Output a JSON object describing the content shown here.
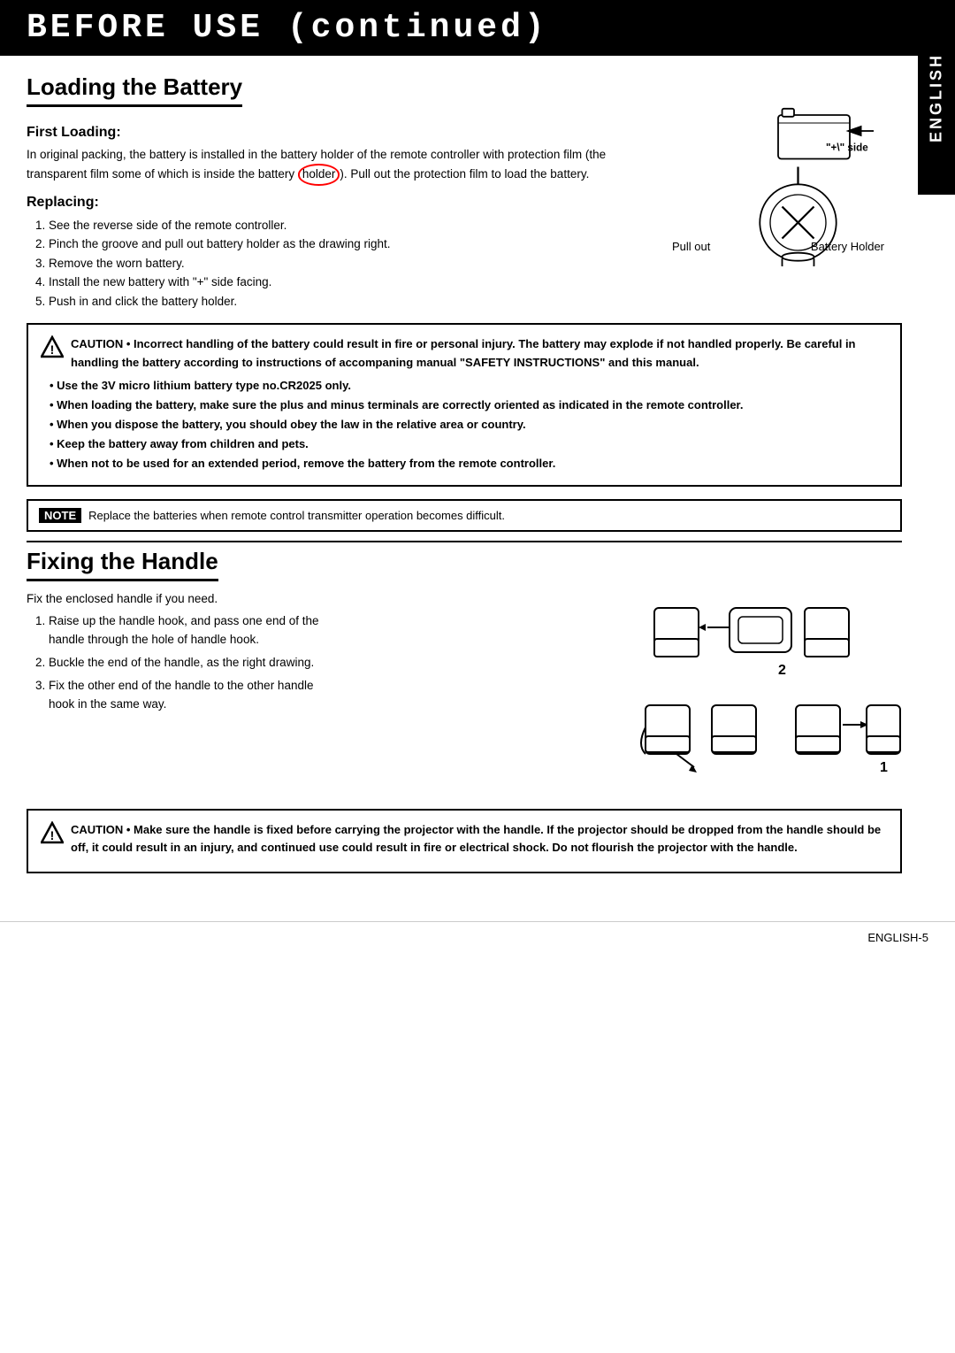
{
  "header": {
    "title": "BEFORE USE (continued)"
  },
  "english_tab": "ENGLISH",
  "loading_battery": {
    "section_title": "Loading the Battery",
    "first_loading_label": "First Loading:",
    "first_loading_text": "In original packing, the battery is installed in the battery holder of the remote controller with protection film (the transparent film some of which is inside the battery holder). Pull out the protection film to load the battery.",
    "replacing_label": "Replacing:",
    "replacing_items": [
      "1. See the reverse side of the remote controller.",
      "2. Pinch the groove and pull out battery holder as the drawing right.",
      "3. Remove the worn battery.",
      "4. Install the new battery with \"+\" side facing.",
      "5. Push in and click the battery holder."
    ],
    "diagram_plus_side": "\"+\" side",
    "diagram_pull_out": "Pull out",
    "diagram_battery_holder": "Battery Holder"
  },
  "caution_battery": {
    "label": "CAUTION",
    "main_text": "• Incorrect handling of the battery could result in fire or personal injury. The battery may explode if not handled properly. Be careful in handling the battery according to instructions of accompaning manual \"SAFETY INSTRUCTIONS\" and this manual.",
    "bullets": [
      "• Use the 3V micro lithium battery type no.CR2025 only.",
      "• When loading the battery, make sure the plus and minus terminals are correctly oriented as indicated in the remote controller.",
      "• When you dispose the battery, you should obey the law in the relative area or country.",
      "• Keep the battery away from children and pets.",
      "• When not to be used for an extended period, remove the battery from the remote controller."
    ]
  },
  "note_battery": {
    "label": "NOTE",
    "text": "Replace the batteries when remote control transmitter operation becomes difficult."
  },
  "fixing_handle": {
    "section_title": "Fixing the Handle",
    "intro_text": "Fix the enclosed handle if you need.",
    "items": [
      "1. Raise up the handle hook, and pass one end of the handle through the hole of handle hook.",
      "2. Buckle the end of the handle, as the right drawing.",
      "3. Fix the other end of the handle to the other handle hook in the same way."
    ],
    "diagram_label_2": "2",
    "diagram_label_1": "1"
  },
  "caution_handle": {
    "label": "CAUTION",
    "text": "• Make sure the handle is fixed before carrying the projector with the handle. If the projector should be dropped from the handle should be off, it could result in an injury, and continued use could result in fire or electrical shock. Do not flourish the projector with the handle."
  },
  "page_number": "ENGLISH-5"
}
